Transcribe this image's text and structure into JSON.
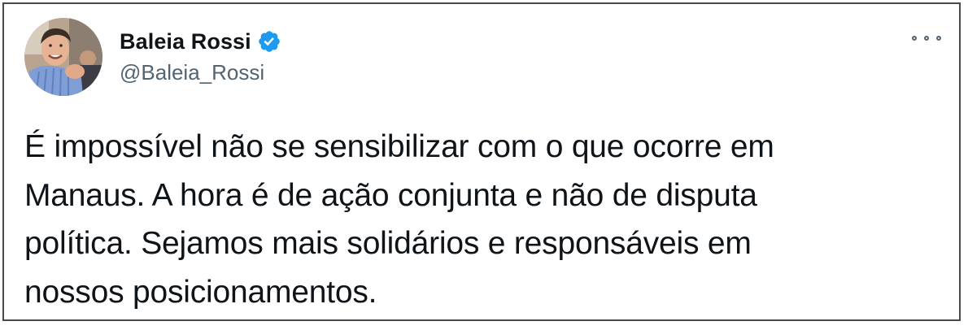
{
  "author": {
    "display_name": "Baleia Rossi",
    "handle": "@Baleia_Rossi",
    "verified": true
  },
  "icons": {
    "verified": "verified-badge-icon",
    "more": "more-options-icon",
    "avatar": "profile-avatar"
  },
  "colors": {
    "verified_blue": "#1d9bf0",
    "text_primary": "#0f1419",
    "text_secondary": "#536471"
  },
  "tweet": {
    "lines": [
      "É impossível não se sensibilizar com o que ocorre em",
      "Manaus. A hora é de ação conjunta e não de disputa",
      "política. Sejamos mais solidários e responsáveis em",
      "nossos posicionamentos."
    ]
  }
}
